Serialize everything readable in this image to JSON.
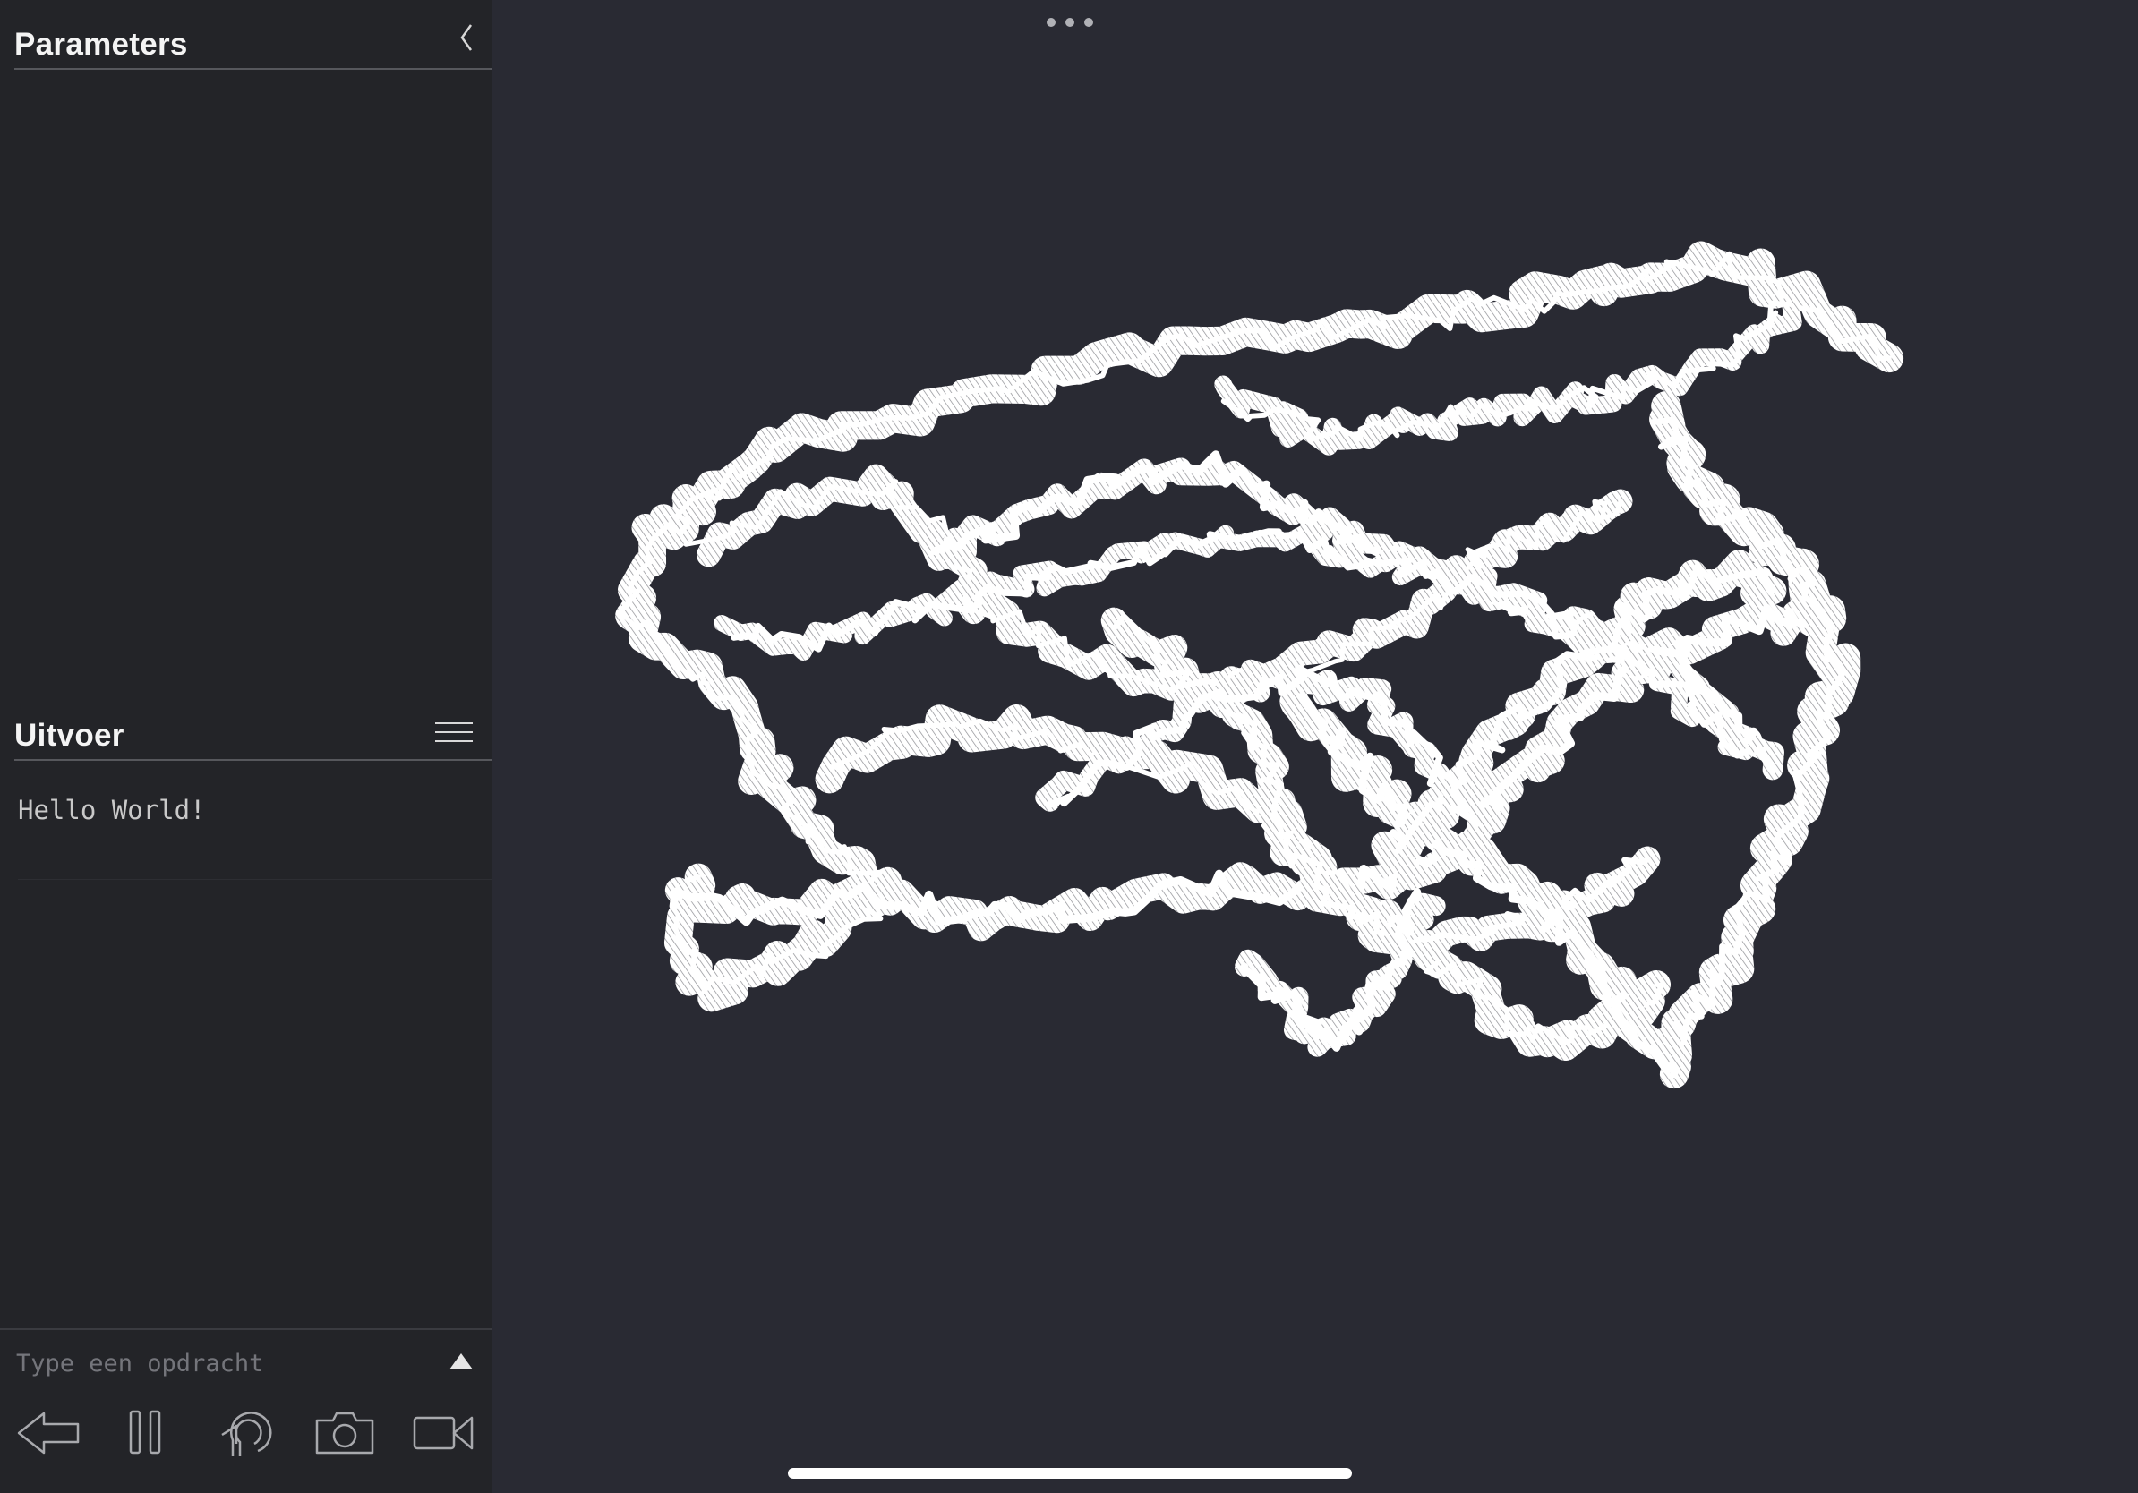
{
  "parameters": {
    "title": "Parameters"
  },
  "output": {
    "title": "Uitvoer",
    "lines": [
      "Hello World!"
    ]
  },
  "command": {
    "placeholder": "Type een opdracht"
  },
  "toolbar": {
    "icons": [
      "back-arrow-icon",
      "pause-icon",
      "restart-icon",
      "camera-icon",
      "video-camera-icon"
    ]
  },
  "colors": {
    "sidebar_bg": "#232428",
    "canvas_bg": "#292a33",
    "drawing": "#ffffff",
    "text": "#f4f4f4"
  }
}
